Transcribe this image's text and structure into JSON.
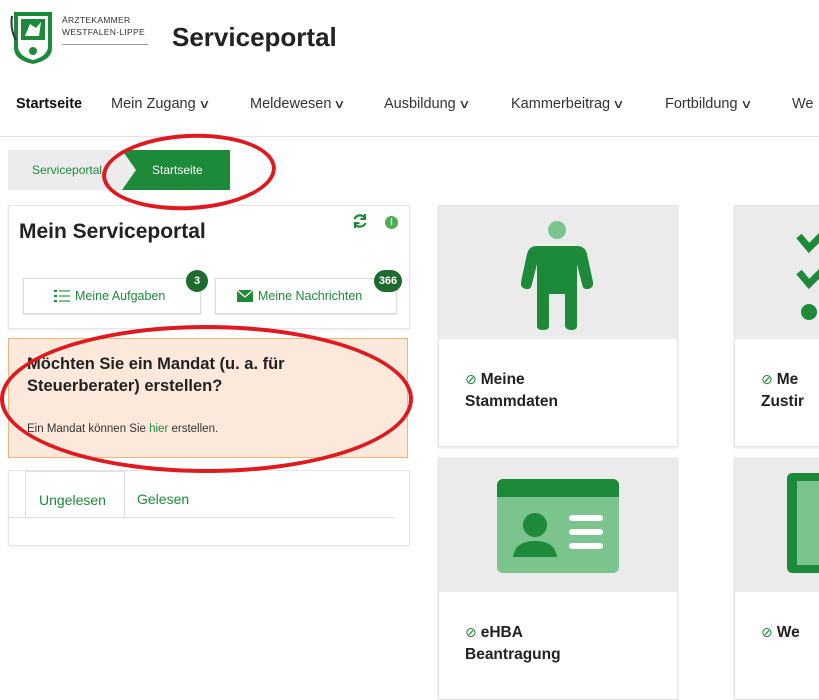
{
  "header": {
    "org_line1": "ÄRZTEKAMMER",
    "org_line2": "WESTFALEN-LIPPE",
    "title": "Serviceportal"
  },
  "nav": {
    "items": [
      {
        "label": "Startseite"
      },
      {
        "label": "Mein Zugang"
      },
      {
        "label": "Meldewesen"
      },
      {
        "label": "Ausbildung"
      },
      {
        "label": "Kammerbeitrag"
      },
      {
        "label": "Fortbildung"
      },
      {
        "label": "We"
      }
    ]
  },
  "breadcrumb": {
    "items": [
      "Serviceportal",
      "Startseite"
    ]
  },
  "portal_card": {
    "title": "Mein Serviceportal",
    "tasks_label": "Meine Aufgaben",
    "tasks_count": "3",
    "messages_label": "Meine Nachrichten",
    "messages_count": "366"
  },
  "mandat": {
    "heading": "Möchten Sie ein Mandat (u. a. für Steuerberater) erstellen?",
    "text_before": "Ein Mandat können Sie ",
    "link": "hier",
    "text_after": " erstellen."
  },
  "tabs": {
    "items": [
      "Ungelesen",
      "Gelesen"
    ]
  },
  "tiles": [
    {
      "line1": "Meine",
      "line2": "Stammdaten"
    },
    {
      "line1": "Me",
      "line2": "Zustir"
    },
    {
      "line1": "eHBA",
      "line2": "Beantragung"
    },
    {
      "line1": "We",
      "line2": ""
    }
  ],
  "colors": {
    "brand_green": "#1d8a3a",
    "light_green": "#7bc48e",
    "annotation_red": "#e0191f",
    "notice_bg": "#fde9dc"
  }
}
